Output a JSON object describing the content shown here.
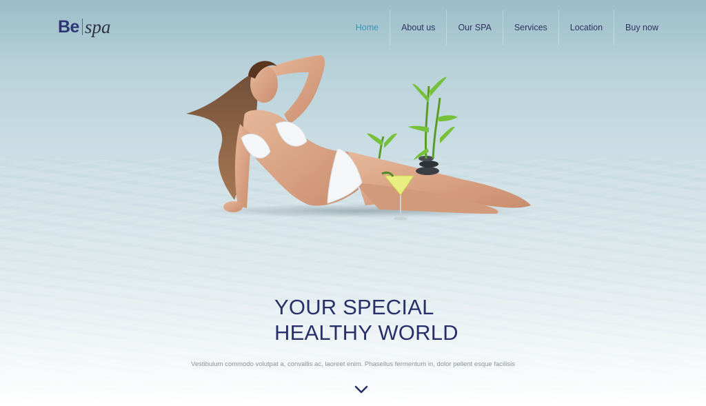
{
  "brand": {
    "logo_bold": "Be",
    "logo_italic": "spa"
  },
  "nav": {
    "items": [
      {
        "label": "Home",
        "active": true
      },
      {
        "label": "About us",
        "active": false
      },
      {
        "label": "Our SPA",
        "active": false
      },
      {
        "label": "Services",
        "active": false
      },
      {
        "label": "Location",
        "active": false
      },
      {
        "label": "Buy now",
        "active": false
      }
    ],
    "active_color": "#3796b0",
    "text_color": "#2c335f"
  },
  "hero": {
    "headline_line1": "YOUR SPECIAL",
    "headline_line2": "HEALTHY WORLD",
    "subtext": "Vestibulum commodo volutpat a, convallis ac, laoreet enim. Phasellus fermentum in, dolor pellent esque facilisis",
    "image_subject": "woman reclining in white bikini with bamboo, stones and cocktail glass",
    "headline_color": "#27306a"
  },
  "scroll": {
    "icon": "chevron-down-icon"
  }
}
